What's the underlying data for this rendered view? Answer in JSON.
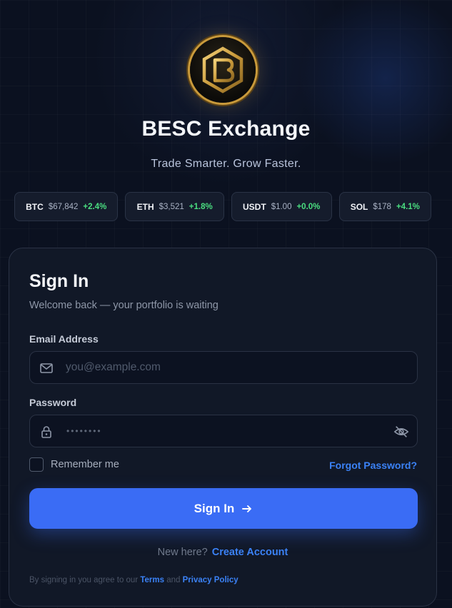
{
  "brand": {
    "name": "BESC Exchange",
    "tagline": "Trade Smarter. Grow Faster.",
    "logo_icon": "hexagon-b-logo-icon"
  },
  "tickers": [
    {
      "symbol": "BTC",
      "price": "$67,842",
      "change": "+2.4%"
    },
    {
      "symbol": "ETH",
      "price": "$3,521",
      "change": "+1.8%"
    },
    {
      "symbol": "USDT",
      "price": "$1.00",
      "change": "+0.0%"
    },
    {
      "symbol": "SOL",
      "price": "$178",
      "change": "+4.1%"
    }
  ],
  "signin": {
    "title": "Sign In",
    "subtitle": "Welcome back — your portfolio is waiting",
    "email": {
      "label": "Email Address",
      "placeholder": "you@example.com",
      "value": "",
      "icon": "mail-icon"
    },
    "password": {
      "label": "Password",
      "masked_value": "••••••••",
      "icon": "lock-icon",
      "toggle_icon": "eye-off-icon"
    },
    "remember_label": "Remember me",
    "remember_checked": false,
    "forgot_label": "Forgot Password?",
    "submit_label": "Sign In",
    "submit_icon": "arrow-right-icon",
    "new_here": "New here?",
    "create_account": "Create Account",
    "legal_prefix": "By signing in you agree to our",
    "terms": "Terms",
    "legal_and": "and",
    "privacy": "Privacy Policy"
  },
  "colors": {
    "background": "#0b1120",
    "card": "#111827",
    "accent": "#3a6cf5",
    "link": "#3b82f6",
    "positive": "#4ade80",
    "gold": "#c99a3b"
  }
}
